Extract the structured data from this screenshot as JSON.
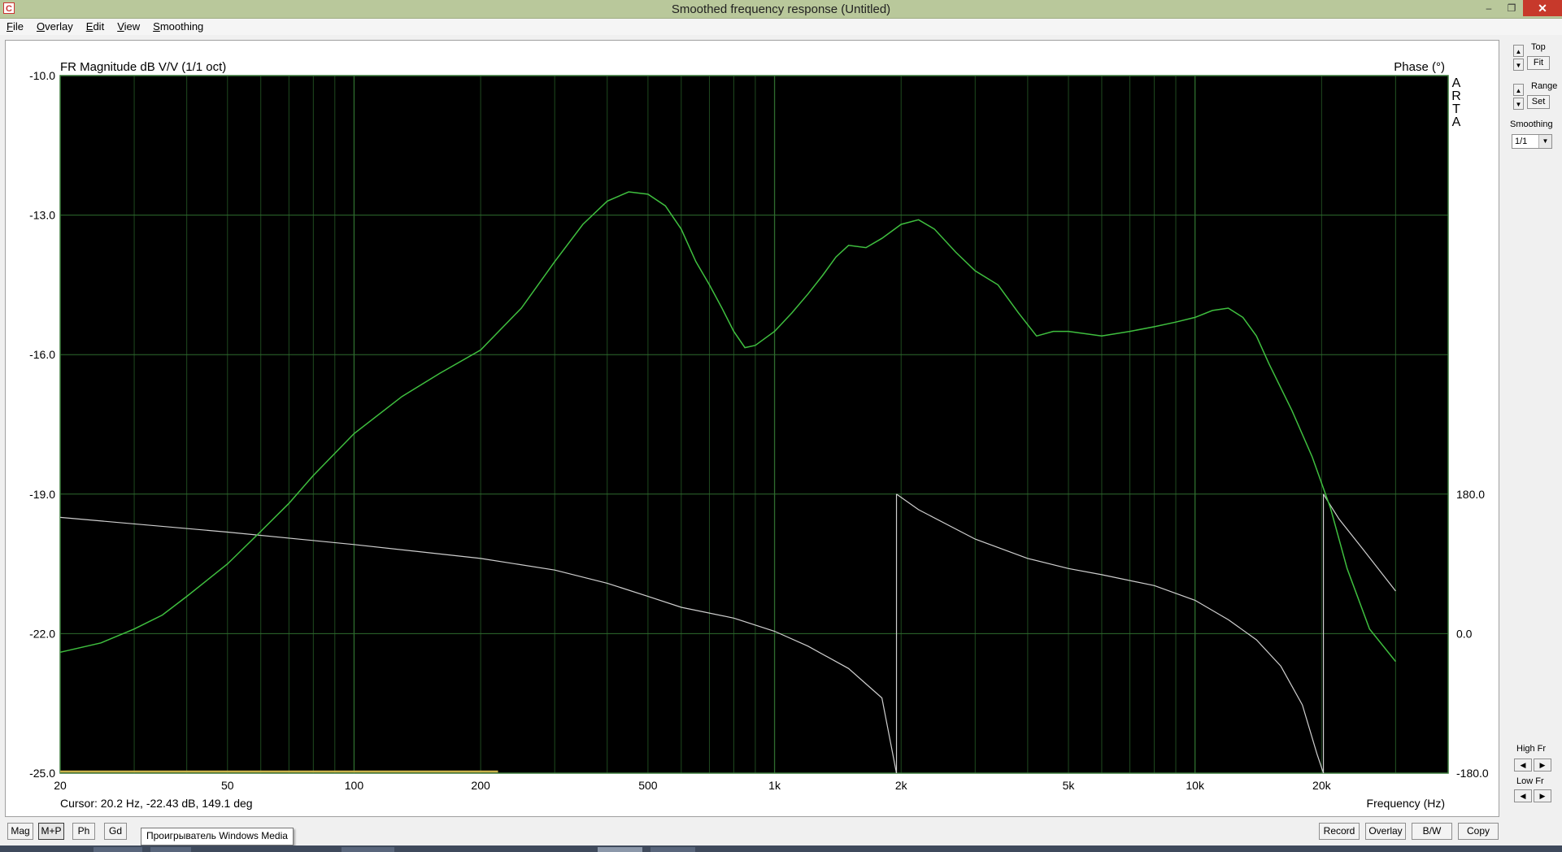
{
  "window": {
    "title": "Smoothed frequency response (Untitled)",
    "icon": "arta-app-icon",
    "icon_letter": "C",
    "controls": {
      "minimize": "–",
      "restore": "❐",
      "close": "✕"
    }
  },
  "menu": [
    "File",
    "Overlay",
    "Edit",
    "View",
    "Smoothing"
  ],
  "plot": {
    "title_left": "FR Magnitude dB V/V (1/1 oct)",
    "title_right": "Phase (°)",
    "watermark": [
      "A",
      "R",
      "T",
      "A"
    ],
    "cursor_text": "Cursor: 20.2 Hz, -22.43 dB, 149.1 deg",
    "xlabel": "Frequency (Hz)"
  },
  "chart_data": {
    "type": "line",
    "x_scale": "log",
    "xlim": [
      20,
      40000
    ],
    "ylim": [
      -25,
      -10
    ],
    "y2lim": [
      -180,
      180
    ],
    "y_ticks": [
      "-10.0",
      "-13.0",
      "-16.0",
      "-19.0",
      "-22.0",
      "-25.0"
    ],
    "y_tick_values": [
      -10,
      -13,
      -16,
      -19,
      -22,
      -25
    ],
    "y2_ticks": [
      "180.0",
      "0.0",
      "-180.0"
    ],
    "y2_tick_values": [
      180,
      0,
      -180
    ],
    "x_ticks": [
      "20",
      "50",
      "100",
      "200",
      "500",
      "1k",
      "2k",
      "5k",
      "10k",
      "20k"
    ],
    "x_tick_values": [
      20,
      50,
      100,
      200,
      500,
      1000,
      2000,
      5000,
      10000,
      20000
    ],
    "grid": true,
    "background": "#000000",
    "grid_color": "#2e6b2e",
    "magnitude_color": "#3fbf3f",
    "phase_color": "#cfcfcf",
    "series": [
      {
        "name": "FR Magnitude dB V/V",
        "axis": "left",
        "points": [
          [
            20,
            -22.4
          ],
          [
            25,
            -22.2
          ],
          [
            30,
            -21.9
          ],
          [
            35,
            -21.6
          ],
          [
            40,
            -21.2
          ],
          [
            50,
            -20.5
          ],
          [
            60,
            -19.8
          ],
          [
            70,
            -19.2
          ],
          [
            80,
            -18.6
          ],
          [
            100,
            -17.7
          ],
          [
            130,
            -16.9
          ],
          [
            160,
            -16.4
          ],
          [
            200,
            -15.9
          ],
          [
            250,
            -15.0
          ],
          [
            300,
            -14.0
          ],
          [
            350,
            -13.2
          ],
          [
            400,
            -12.7
          ],
          [
            450,
            -12.5
          ],
          [
            500,
            -12.55
          ],
          [
            550,
            -12.8
          ],
          [
            600,
            -13.3
          ],
          [
            650,
            -14.0
          ],
          [
            700,
            -14.5
          ],
          [
            750,
            -15.0
          ],
          [
            800,
            -15.5
          ],
          [
            850,
            -15.85
          ],
          [
            900,
            -15.8
          ],
          [
            1000,
            -15.5
          ],
          [
            1100,
            -15.1
          ],
          [
            1200,
            -14.7
          ],
          [
            1300,
            -14.3
          ],
          [
            1400,
            -13.9
          ],
          [
            1500,
            -13.65
          ],
          [
            1650,
            -13.7
          ],
          [
            1800,
            -13.5
          ],
          [
            2000,
            -13.2
          ],
          [
            2200,
            -13.1
          ],
          [
            2400,
            -13.3
          ],
          [
            2700,
            -13.8
          ],
          [
            3000,
            -14.2
          ],
          [
            3400,
            -14.5
          ],
          [
            3800,
            -15.1
          ],
          [
            4200,
            -15.6
          ],
          [
            4600,
            -15.5
          ],
          [
            5000,
            -15.5
          ],
          [
            6000,
            -15.6
          ],
          [
            7000,
            -15.5
          ],
          [
            8000,
            -15.4
          ],
          [
            9000,
            -15.3
          ],
          [
            10000,
            -15.2
          ],
          [
            11000,
            -15.05
          ],
          [
            12000,
            -15.0
          ],
          [
            13000,
            -15.2
          ],
          [
            14000,
            -15.6
          ],
          [
            15000,
            -16.2
          ],
          [
            17000,
            -17.2
          ],
          [
            19000,
            -18.2
          ],
          [
            21000,
            -19.3
          ],
          [
            23000,
            -20.6
          ],
          [
            26000,
            -21.9
          ],
          [
            30000,
            -22.6
          ]
        ]
      },
      {
        "name": "Phase",
        "axis": "right",
        "segments": [
          [
            [
              20,
              150
            ],
            [
              50,
              131
            ],
            [
              100,
              115
            ],
            [
              200,
              97
            ],
            [
              300,
              82
            ],
            [
              400,
              65
            ],
            [
              500,
              48
            ],
            [
              600,
              34
            ],
            [
              800,
              20
            ],
            [
              1000,
              3
            ],
            [
              1200,
              -16
            ],
            [
              1500,
              -45
            ],
            [
              1800,
              -83
            ],
            [
              1950,
              -180
            ]
          ],
          [
            [
              1950,
              180
            ],
            [
              2200,
              160
            ],
            [
              3000,
              122
            ],
            [
              4000,
              97
            ],
            [
              5000,
              84
            ],
            [
              6000,
              76
            ],
            [
              8000,
              62
            ],
            [
              10000,
              43
            ],
            [
              12000,
              18
            ],
            [
              14000,
              -8
            ],
            [
              16000,
              -42
            ],
            [
              18000,
              -92
            ],
            [
              19500,
              -155
            ],
            [
              20200,
              -180
            ]
          ],
          [
            [
              20200,
              180
            ],
            [
              22000,
              148
            ],
            [
              25000,
              110
            ],
            [
              30000,
              55
            ]
          ]
        ]
      }
    ]
  },
  "side_panel": {
    "top_label": "Top",
    "fit_label": "Fit",
    "range_label": "Range",
    "set_label": "Set",
    "smoothing_label": "Smoothing",
    "smoothing_value": "1/1",
    "high_fr_label": "High Fr",
    "low_fr_label": "Low Fr"
  },
  "bottom_bar": {
    "left_buttons": [
      "Mag",
      "M+P",
      "Ph",
      "Gd"
    ],
    "right_buttons": [
      "Record",
      "Overlay",
      "B/W",
      "Copy"
    ],
    "tooltip": "Проигрыватель Windows Media"
  }
}
